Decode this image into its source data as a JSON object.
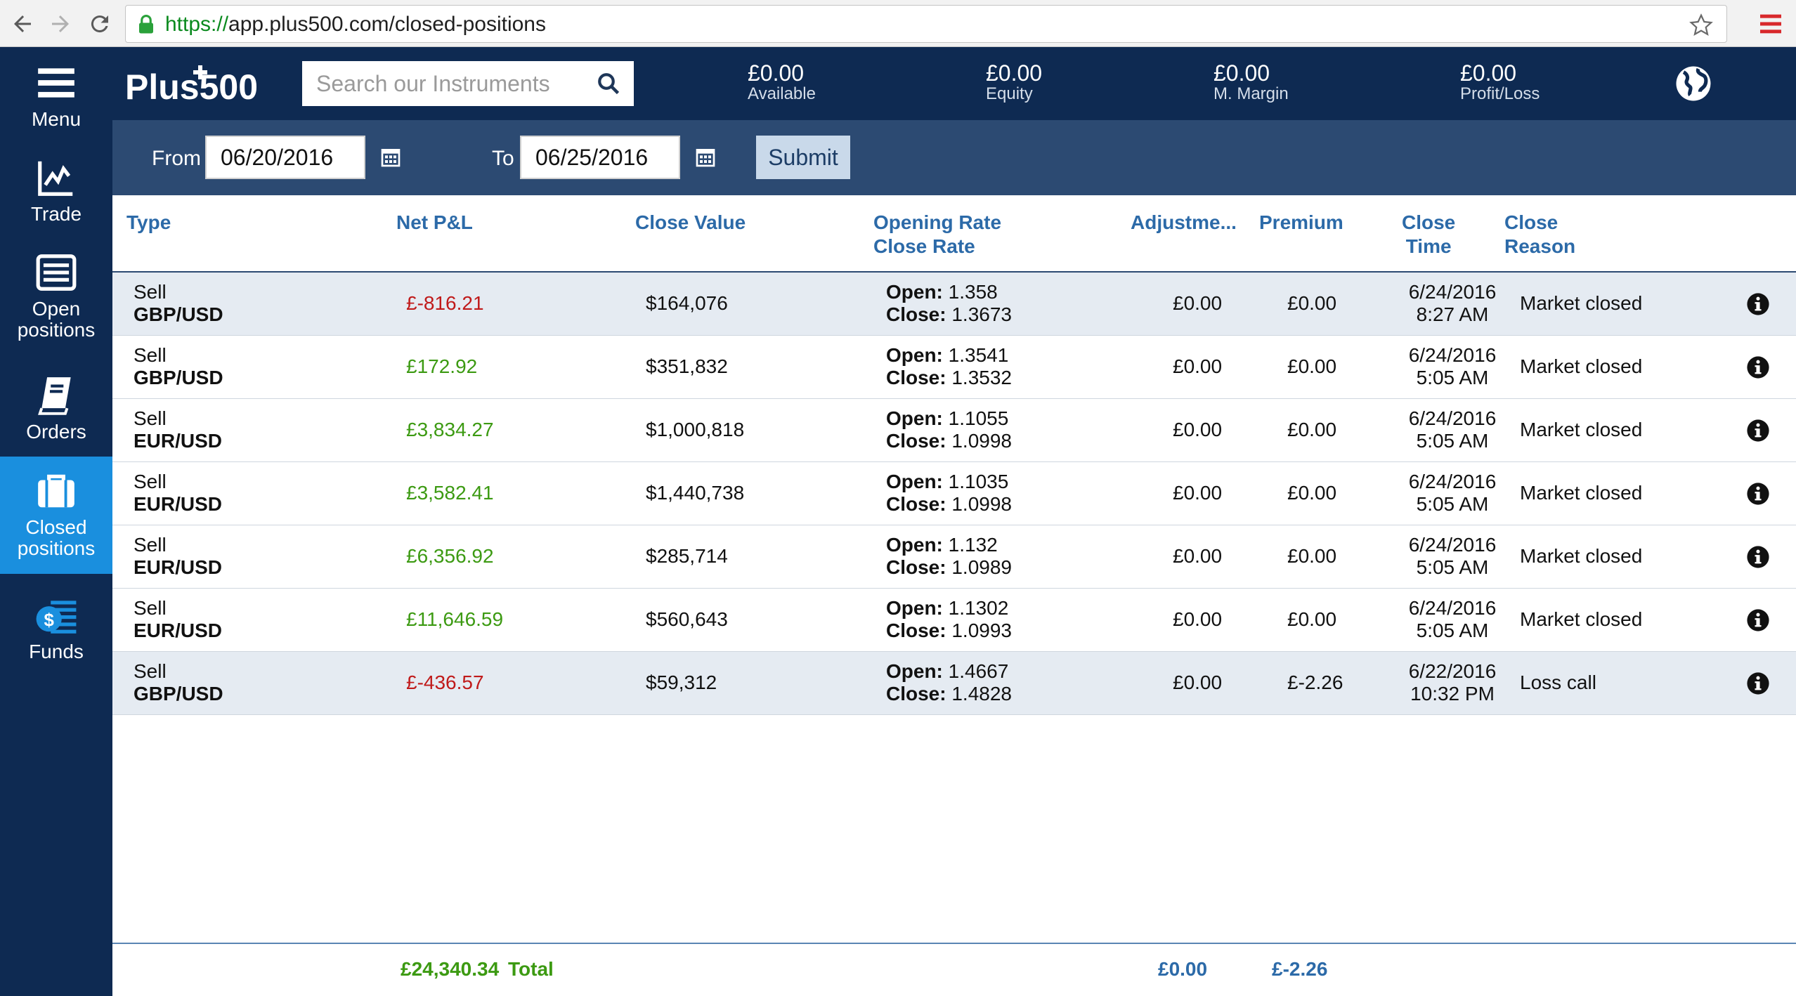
{
  "browser": {
    "url_scheme": "https://",
    "url_rest": "app.plus500.com/closed-positions"
  },
  "sidebar": {
    "items": [
      {
        "label": "Menu",
        "icon": "hamburger-icon"
      },
      {
        "label": "Trade",
        "icon": "chart-line-icon"
      },
      {
        "label": "Open positions",
        "icon": "list-icon"
      },
      {
        "label": "Orders",
        "icon": "book-icon"
      },
      {
        "label": "Closed positions",
        "icon": "briefcase-icon",
        "active": true
      },
      {
        "label": "Funds",
        "icon": "money-icon"
      }
    ]
  },
  "header": {
    "logo_text": "Plus500",
    "search_placeholder": "Search our Instruments",
    "stats": [
      {
        "value": "£0.00",
        "label": "Available"
      },
      {
        "value": "£0.00",
        "label": "Equity"
      },
      {
        "value": "£0.00",
        "label": "M. Margin"
      },
      {
        "value": "£0.00",
        "label": "Profit/Loss"
      }
    ]
  },
  "filter": {
    "from_label": "From",
    "from_value": "06/20/2016",
    "to_label": "To",
    "to_value": "06/25/2016",
    "submit_label": "Submit"
  },
  "table": {
    "headers": {
      "type": "Type",
      "net_pl": "Net P&L",
      "close_value": "Close Value",
      "rate_line1": "Opening Rate",
      "rate_line2": "Close Rate",
      "adjustment": "Adjustme...",
      "premium": "Premium",
      "close_time_line1": "Close",
      "close_time_line2": "Time",
      "close_reason_line1": "Close",
      "close_reason_line2": "Reason"
    },
    "open_prefix": "Open:",
    "close_prefix": "Close:",
    "rows": [
      {
        "side": "Sell",
        "pair": "GBP/USD",
        "net_pl": "£-816.21",
        "pl_sign": "neg",
        "close_value": "$164,076",
        "open": "1.358",
        "close": "1.3673",
        "adjustment": "£0.00",
        "premium": "£0.00",
        "date": "6/24/2016",
        "time": "8:27 AM",
        "reason": "Market closed"
      },
      {
        "side": "Sell",
        "pair": "GBP/USD",
        "net_pl": "£172.92",
        "pl_sign": "pos",
        "close_value": "$351,832",
        "open": "1.3541",
        "close": "1.3532",
        "adjustment": "£0.00",
        "premium": "£0.00",
        "date": "6/24/2016",
        "time": "5:05 AM",
        "reason": "Market closed"
      },
      {
        "side": "Sell",
        "pair": "EUR/USD",
        "net_pl": "£3,834.27",
        "pl_sign": "pos",
        "close_value": "$1,000,818",
        "open": "1.1055",
        "close": "1.0998",
        "adjustment": "£0.00",
        "premium": "£0.00",
        "date": "6/24/2016",
        "time": "5:05 AM",
        "reason": "Market closed"
      },
      {
        "side": "Sell",
        "pair": "EUR/USD",
        "net_pl": "£3,582.41",
        "pl_sign": "pos",
        "close_value": "$1,440,738",
        "open": "1.1035",
        "close": "1.0998",
        "adjustment": "£0.00",
        "premium": "£0.00",
        "date": "6/24/2016",
        "time": "5:05 AM",
        "reason": "Market closed"
      },
      {
        "side": "Sell",
        "pair": "EUR/USD",
        "net_pl": "£6,356.92",
        "pl_sign": "pos",
        "close_value": "$285,714",
        "open": "1.132",
        "close": "1.0989",
        "adjustment": "£0.00",
        "premium": "£0.00",
        "date": "6/24/2016",
        "time": "5:05 AM",
        "reason": "Market closed"
      },
      {
        "side": "Sell",
        "pair": "EUR/USD",
        "net_pl": "£11,646.59",
        "pl_sign": "pos",
        "close_value": "$560,643",
        "open": "1.1302",
        "close": "1.0993",
        "adjustment": "£0.00",
        "premium": "£0.00",
        "date": "6/24/2016",
        "time": "5:05 AM",
        "reason": "Market closed"
      },
      {
        "side": "Sell",
        "pair": "GBP/USD",
        "net_pl": "£-436.57",
        "pl_sign": "neg",
        "close_value": "$59,312",
        "open": "1.4667",
        "close": "1.4828",
        "adjustment": "£0.00",
        "premium": "£-2.26",
        "date": "6/22/2016",
        "time": "10:32 PM",
        "reason": "Loss call"
      }
    ],
    "footer": {
      "net_total": "£24,340.34",
      "total_label": "Total",
      "adjustment_total": "£0.00",
      "premium_total": "£-2.26"
    }
  }
}
